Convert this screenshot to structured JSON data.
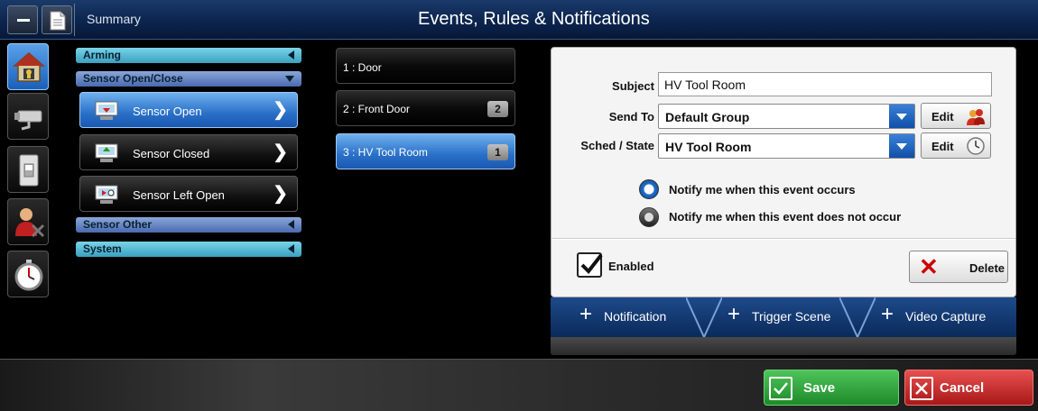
{
  "header": {
    "summary_label": "Summary",
    "title": "Events, Rules & Notifications"
  },
  "sidebar_icons": [
    {
      "name": "security-home-icon",
      "active": true
    },
    {
      "name": "camera-icon",
      "active": false
    },
    {
      "name": "light-switch-icon",
      "active": false
    },
    {
      "name": "user-tools-icon",
      "active": false
    },
    {
      "name": "stopwatch-icon",
      "active": false
    }
  ],
  "categories": {
    "arming": "Arming",
    "sensor_open_close": "Sensor Open/Close",
    "items": [
      {
        "label": "Sensor Open",
        "active": true
      },
      {
        "label": "Sensor Closed",
        "active": false
      },
      {
        "label": "Sensor Left Open",
        "active": false
      }
    ],
    "sensor_other": "Sensor Other",
    "system": "System"
  },
  "events": [
    {
      "label": "1 : Door",
      "badge": ""
    },
    {
      "label": "2 : Front Door",
      "badge": "2"
    },
    {
      "label": "3 : HV Tool Room",
      "badge": "1"
    }
  ],
  "form": {
    "subject_label": "Subject",
    "subject_value": "HV Tool Room",
    "send_to_label": "Send To",
    "send_to_value": "Default Group",
    "sched_label": "Sched / State",
    "sched_value": "HV Tool Room",
    "edit_label": "Edit",
    "radio_occurs": "Notify me when this event occurs",
    "radio_not_occurs": "Notify me when this event does not occur",
    "enabled_label": "Enabled",
    "delete_label": "Delete"
  },
  "tabs": [
    {
      "label": "Notification"
    },
    {
      "label": "Trigger Scene"
    },
    {
      "label": "Video Capture"
    }
  ],
  "footer": {
    "save_label": "Save",
    "cancel_label": "Cancel"
  },
  "colors": {
    "accent_blue": "#2a70c8",
    "save_green": "#1e8a2a",
    "cancel_red": "#a81818"
  }
}
